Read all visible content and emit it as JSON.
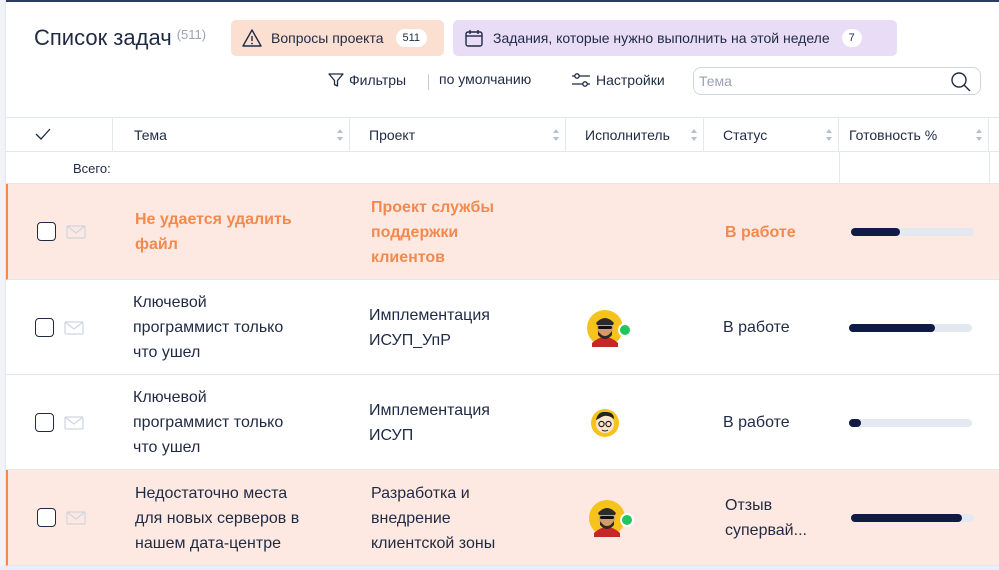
{
  "header": {
    "title": "Список задач",
    "count": "(511)"
  },
  "chips": {
    "questions": {
      "label": "Вопросы проекта",
      "badge": "511",
      "color": "#fbe0d2"
    },
    "week": {
      "label": "Задания, которые нужно выполнить на этой неделе",
      "badge": "7",
      "color": "#e8dcf6"
    }
  },
  "toolbar": {
    "filters_label": "Фильтры",
    "default_label": "по умолчанию",
    "settings_label": "Настройки",
    "search_placeholder": "Тема"
  },
  "table": {
    "columns": {
      "topic": "Тема",
      "project": "Проект",
      "assignee": "Исполнитель",
      "status": "Статус",
      "progress": "Готовность %"
    },
    "total_label": "Всего:",
    "rows": [
      {
        "topic_lines": [
          "Не удается удалить",
          "файл"
        ],
        "project_lines": [
          "Проект службы",
          "поддержки",
          "клиентов"
        ],
        "status_lines": [
          "В работе"
        ],
        "assignee": "",
        "progress": 40
      },
      {
        "topic_lines": [
          "Ключевой",
          "программист только",
          "что ушел"
        ],
        "project_lines": [
          "Имплементация",
          "ИСУП_УпР"
        ],
        "status_lines": [
          "В работе"
        ],
        "assignee": "avatar-turban",
        "progress": 70
      },
      {
        "topic_lines": [
          "Ключевой",
          "программист только",
          "что ушел"
        ],
        "project_lines": [
          "Имплементация",
          "ИСУП"
        ],
        "status_lines": [
          "В работе"
        ],
        "assignee": "avatar-glasses",
        "progress": 10
      },
      {
        "topic_lines": [
          "Недостаточно места",
          "для новых серверов в",
          "нашем дата-центре"
        ],
        "project_lines": [
          "Разработка и",
          "внедрение",
          "клиентской зоны"
        ],
        "status_lines": [
          "Отзыв",
          "супервай..."
        ],
        "assignee": "avatar-turban",
        "progress": 90
      }
    ]
  },
  "colors": {
    "accent_orange": "#f28a4f",
    "progress_fill": "#0f1a45",
    "online": "#22c55e"
  }
}
